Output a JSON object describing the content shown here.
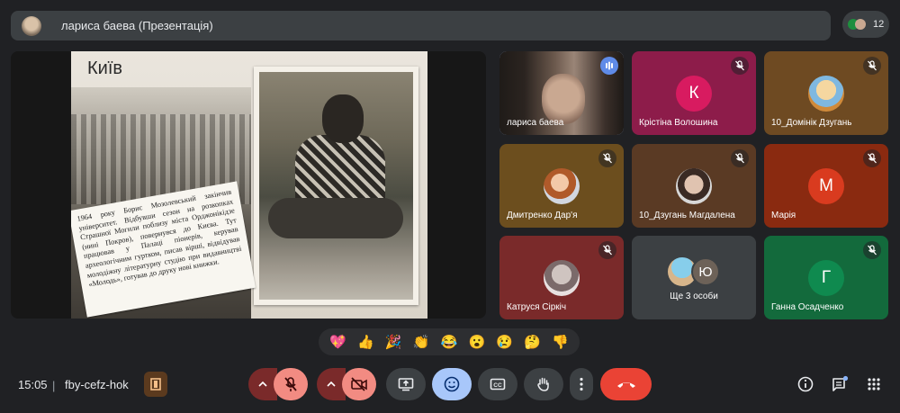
{
  "topbar": {
    "presenter_title": "лариса баева (Презентація)",
    "participant_count": "12"
  },
  "slide": {
    "title": "Київ",
    "caption": "1964 року Борис Мозолевський закінчив університет. Відбувши сезон на розкопках Страшної Могили поблизу міста Орджонікідзе (нині Покров), повернувся до Києва. Тут працював у Палаці піонерів, керував археологічним гуртком, писав вірші, відвідував молодіжну літературну студію при видавництві «Молодь», готував до друку нові книжки."
  },
  "tiles": [
    {
      "name": "лариса баева",
      "type": "video",
      "speaking": true
    },
    {
      "name": "Крістіна Волошина",
      "type": "letter",
      "letter": "К",
      "bg": "#8d1c4a",
      "avatar": "#d81b60",
      "muted": true
    },
    {
      "name": "10_Домінік Дзугань",
      "type": "image",
      "bg": "#6e4a22",
      "muted": true
    },
    {
      "name": "Дмитренко Дар'я",
      "type": "image",
      "bg": "#6c4e1e",
      "muted": true
    },
    {
      "name": "10_Дзугань Магдалена",
      "type": "image",
      "bg": "#5a3a24",
      "muted": true
    },
    {
      "name": "Марія",
      "type": "letter",
      "letter": "М",
      "bg": "#8a2a10",
      "avatar": "#d93b1f",
      "muted": true
    },
    {
      "name": "Катруся Сіркіч",
      "type": "image",
      "bg": "#7a2a2a",
      "muted": true
    },
    {
      "name": "Ще 3 особи",
      "type": "more",
      "more_letter": "Ю",
      "bg": "#3c4043"
    },
    {
      "name": "Ганна Осадченко",
      "type": "letter",
      "letter": "Г",
      "bg": "#136a3c",
      "avatar": "#0f8a4f",
      "muted": true
    }
  ],
  "reactions": [
    "💖",
    "👍",
    "🎉",
    "👏",
    "😂",
    "😮",
    "😢",
    "🤔",
    "👎"
  ],
  "bottom": {
    "time": "15:05",
    "separator": "|",
    "meeting_code": "fby-cefz-hok"
  }
}
